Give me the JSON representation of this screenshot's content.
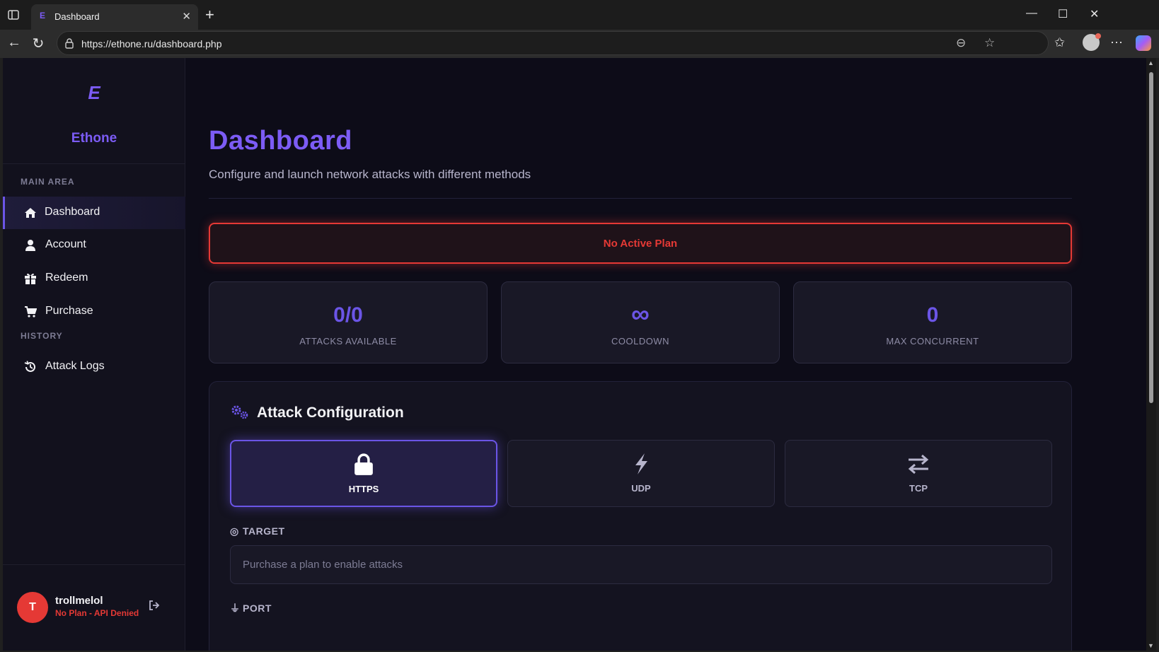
{
  "browser": {
    "tab_title": "Dashboard",
    "tab_favicon": "E",
    "url": "https://ethone.ru/dashboard.php"
  },
  "sidebar": {
    "brand_logo": "E",
    "brand_name": "Ethone",
    "section_main": "MAIN AREA",
    "section_history": "HISTORY",
    "items": [
      {
        "label": "Dashboard",
        "icon": "home-icon"
      },
      {
        "label": "Account",
        "icon": "user-icon"
      },
      {
        "label": "Redeem",
        "icon": "gift-icon"
      },
      {
        "label": "Purchase",
        "icon": "cart-icon"
      },
      {
        "label": "Attack Logs",
        "icon": "history-icon"
      }
    ],
    "user": {
      "avatar_initial": "T",
      "username": "trollmelol",
      "status": "No Plan - API Denied"
    }
  },
  "main": {
    "title": "Dashboard",
    "subtitle": "Configure and launch network attacks with different methods",
    "alert": "No Active Plan",
    "stats": [
      {
        "value": "0/0",
        "label": "ATTACKS AVAILABLE"
      },
      {
        "value": "∞",
        "label": "COOLDOWN"
      },
      {
        "value": "0",
        "label": "MAX CONCURRENT"
      }
    ],
    "config": {
      "title": "Attack Configuration",
      "methods": [
        {
          "label": "HTTPS",
          "icon": "lock-icon",
          "selected": true
        },
        {
          "label": "UDP",
          "icon": "bolt-icon",
          "selected": false
        },
        {
          "label": "TCP",
          "icon": "exchange-icon",
          "selected": false
        }
      ],
      "target_label": "TARGET",
      "target_placeholder": "Purchase a plan to enable attacks",
      "port_label": "PORT"
    }
  },
  "colors": {
    "accent": "#7c5cf5",
    "danger": "#e53935",
    "background": "#0d0c18"
  }
}
